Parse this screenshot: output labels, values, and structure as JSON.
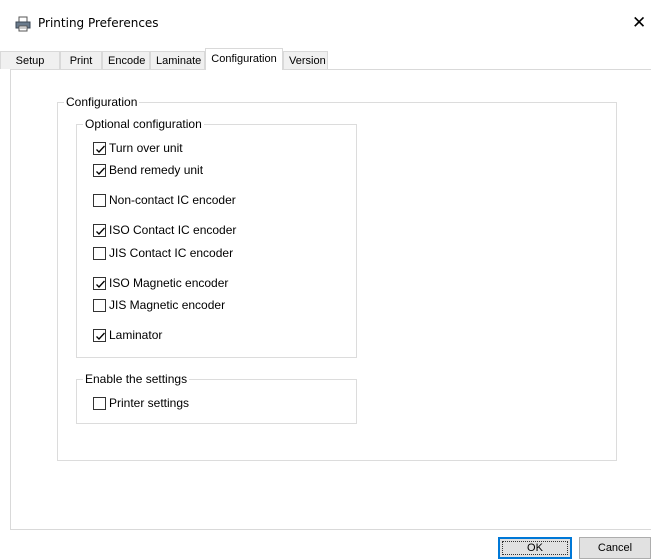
{
  "window": {
    "title": "Printing Preferences",
    "close_glyph": "✕"
  },
  "tabs": [
    {
      "label": "Setup",
      "active": false
    },
    {
      "label": "Print",
      "active": false
    },
    {
      "label": "Encode",
      "active": false
    },
    {
      "label": "Laminate",
      "active": false
    },
    {
      "label": "Configuration",
      "active": true
    },
    {
      "label": "Version",
      "active": false
    }
  ],
  "configuration": {
    "group_title": "Configuration",
    "optional": {
      "group_title": "Optional configuration",
      "items": [
        {
          "label": "Turn over unit",
          "checked": true
        },
        {
          "label": "Bend remedy unit",
          "checked": true
        },
        {
          "label": "Non-contact IC encoder",
          "checked": false
        },
        {
          "label": "ISO Contact IC encoder",
          "checked": true
        },
        {
          "label": "JIS Contact IC encoder",
          "checked": false
        },
        {
          "label": "ISO Magnetic encoder",
          "checked": true
        },
        {
          "label": "JIS Magnetic encoder",
          "checked": false
        },
        {
          "label": "Laminator",
          "checked": true
        }
      ]
    },
    "enable": {
      "group_title": "Enable the settings",
      "items": [
        {
          "label": "Printer settings",
          "checked": false
        }
      ]
    }
  },
  "buttons": {
    "ok_label": "OK",
    "cancel_label": "Cancel"
  },
  "icons": {
    "title_icon": "printer-icon",
    "close_icon": "close-icon",
    "check_icon": "checkmark-icon"
  },
  "colors": {
    "accent": "#0078d7",
    "tab_inactive_bg": "#f0f0f0",
    "button_bg": "#e1e1e1"
  }
}
